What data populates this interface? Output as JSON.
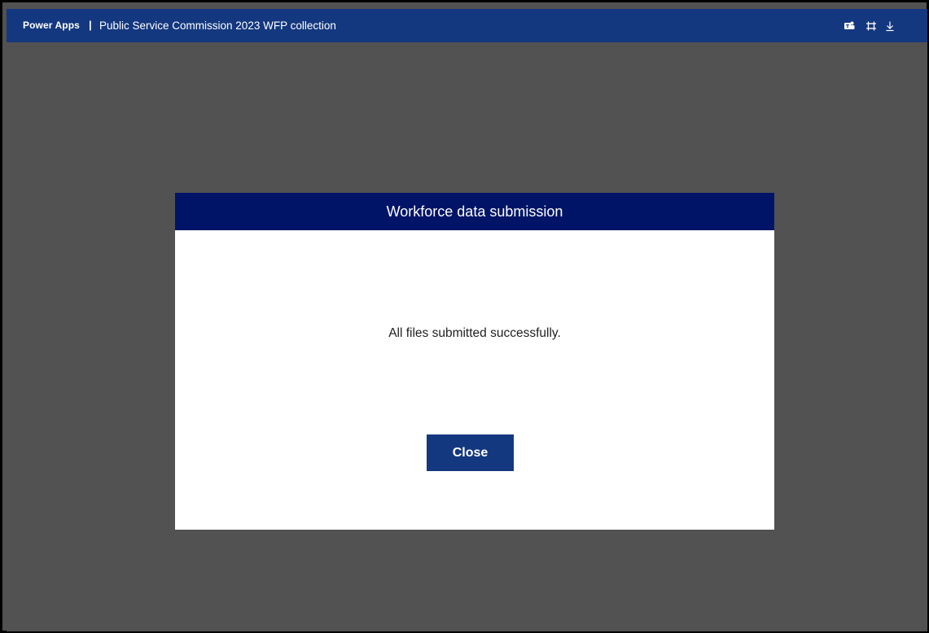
{
  "topbar": {
    "brand": "Power Apps",
    "separator": "|",
    "app_title": "Public Service Commission 2023 WFP collection",
    "icons": [
      "teams-icon",
      "fit-to-window-icon",
      "download-icon"
    ]
  },
  "dialog": {
    "title": "Workforce data submission",
    "message": "All files submitted successfully.",
    "close_label": "Close"
  },
  "colors": {
    "topbar": "#14387f",
    "canvas": "#525252",
    "dialog_header": "#001467",
    "button": "#14387f"
  }
}
